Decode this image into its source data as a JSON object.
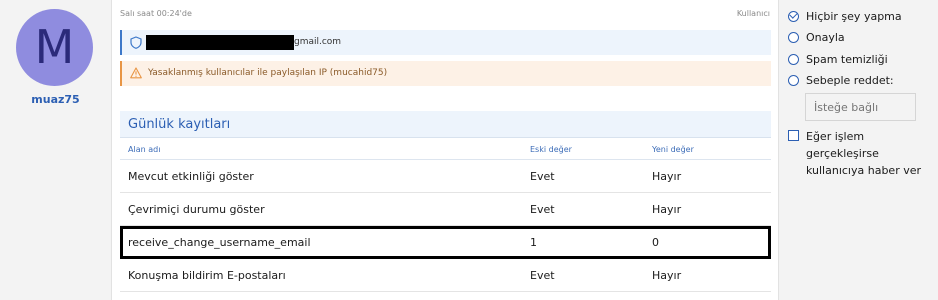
{
  "user": {
    "avatar_letter": "M",
    "name": "muaz75"
  },
  "meta": {
    "time": "Salı saat 00:24'de",
    "user_link": "Kullanıcı"
  },
  "notices": {
    "email_suffix": "gmail.com",
    "shared_ip": "Yasaklanmış kullanıcılar ile paylaşılan IP (mucahid75)"
  },
  "log": {
    "title": "Günlük kayıtları",
    "columns": [
      "Alan adı",
      "Eski değer",
      "Yeni değer"
    ],
    "rows": [
      [
        "Mevcut etkinliği göster",
        "Evet",
        "Hayır"
      ],
      [
        "Çevrimiçi durumu göster",
        "Evet",
        "Hayır"
      ],
      [
        "receive_change_username_email",
        "1",
        "0"
      ],
      [
        "Konuşma bildirim E-postaları",
        "Evet",
        "Hayır"
      ]
    ]
  },
  "actions": {
    "options": [
      "Hiçbir şey yapma",
      "Onayla",
      "Spam temizliği",
      "Sebeple reddet:"
    ],
    "selected_index": 0,
    "reason_placeholder": "İsteğe bağlı",
    "notify_label": "Eğer işlem gerçekleşirse kullanıcıya haber ver"
  },
  "colors": {
    "accent": "#2c5fb3",
    "avatar_bg": "#8f8cdf",
    "warning": "#e89544"
  },
  "icons": {
    "email_notice": "shield-icon",
    "ip_notice": "warning-icon"
  }
}
